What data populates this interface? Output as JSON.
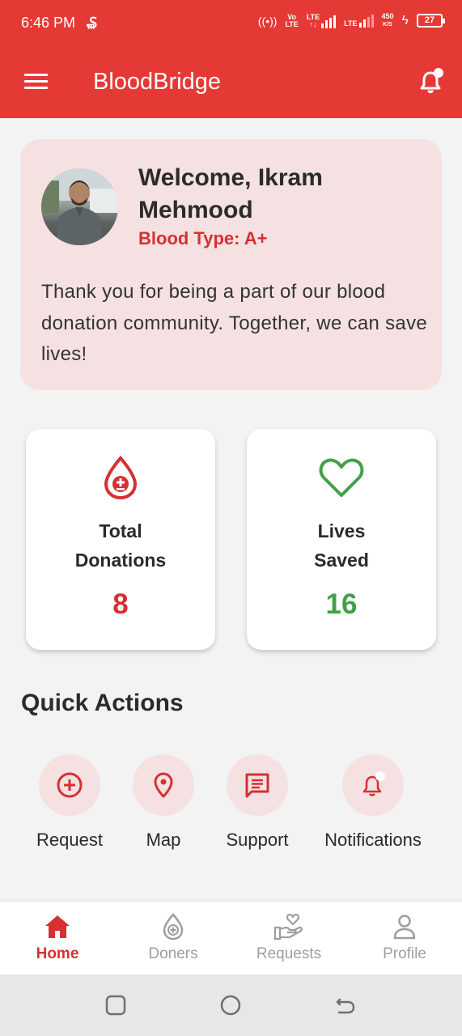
{
  "status_bar": {
    "time": "6:46 PM",
    "speed_value": "450",
    "speed_unit": "K/S",
    "battery": "27"
  },
  "app": {
    "title": "BloodBridge",
    "accent_color": "#e53935"
  },
  "welcome": {
    "greeting": "Welcome, Ikram Mehmood",
    "blood_type": "Blood Type: A+",
    "message": "Thank you for being a part of our blood donation community. Together, we can save lives!"
  },
  "stats": [
    {
      "label_line1": "Total",
      "label_line2": "Donations",
      "value": "8",
      "color": "#d63031",
      "icon": "blood-drop-icon"
    },
    {
      "label_line1": "Lives",
      "label_line2": "Saved",
      "value": "16",
      "color": "#43a047",
      "icon": "heart-icon"
    }
  ],
  "quick_actions": {
    "title": "Quick Actions",
    "items": [
      {
        "label": "Request",
        "icon": "add-circle-icon"
      },
      {
        "label": "Map",
        "icon": "location-pin-icon"
      },
      {
        "label": "Support",
        "icon": "chat-icon"
      },
      {
        "label": "Notifications",
        "icon": "bell-icon"
      }
    ]
  },
  "bottom_nav": {
    "items": [
      {
        "label": "Home",
        "icon": "home-icon",
        "active": true
      },
      {
        "label": "Doners",
        "icon": "blood-drop-icon",
        "active": false
      },
      {
        "label": "Requests",
        "icon": "hand-heart-icon",
        "active": false
      },
      {
        "label": "Profile",
        "icon": "person-icon",
        "active": false
      }
    ]
  }
}
